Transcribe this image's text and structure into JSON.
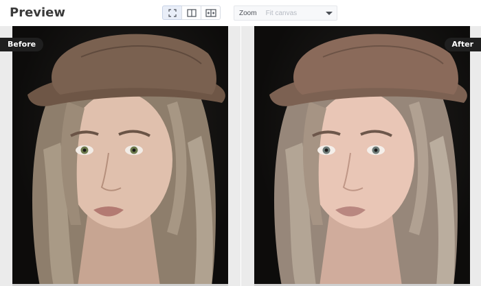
{
  "header": {
    "title": "Preview"
  },
  "view_modes": [
    {
      "icon": "fit-screen-icon",
      "active": true
    },
    {
      "icon": "split-view-icon",
      "active": false
    },
    {
      "icon": "compare-slider-icon",
      "active": false
    }
  ],
  "zoom": {
    "label": "Zoom",
    "value": "Fit canvas",
    "icon": "chevron-down-icon"
  },
  "panels": {
    "before": {
      "label": "Before"
    },
    "after": {
      "label": "After"
    }
  },
  "colors": {
    "tag_bg": "#1f1f1f",
    "canvas_bg": "#ebebeb",
    "hat_before": "#7a6150",
    "hat_after": "#8a6a5a",
    "skin_before": "#e0c0ad",
    "skin_after": "#e9c6b6"
  }
}
